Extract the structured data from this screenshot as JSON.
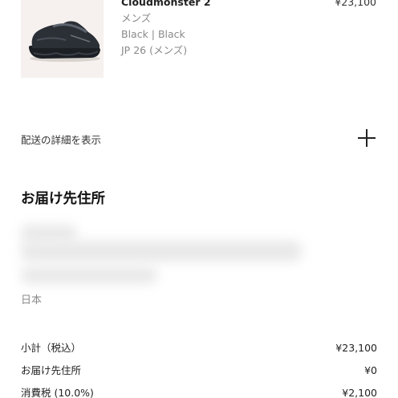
{
  "product": {
    "name": "Cloudmonster 2",
    "category": "メンズ",
    "color": "Black | Black",
    "size": "JP 26 (メンズ)",
    "price": "¥23,100"
  },
  "shipping": {
    "details_label": "配送の詳細を表示",
    "toggle_icon": "plus-icon"
  },
  "address": {
    "title": "お届け先住所",
    "country": "日本"
  },
  "summary": {
    "rows": [
      {
        "label": "小計（税込）",
        "value": "¥23,100"
      },
      {
        "label": "お届け先住所",
        "value": "¥0"
      },
      {
        "label": "消費税 (10.0%)",
        "value": "¥2,100"
      }
    ]
  },
  "colors": {
    "text": "#1a1a1a",
    "muted": "#8a8a8a",
    "thumb_bg": "#f6f1ee"
  }
}
